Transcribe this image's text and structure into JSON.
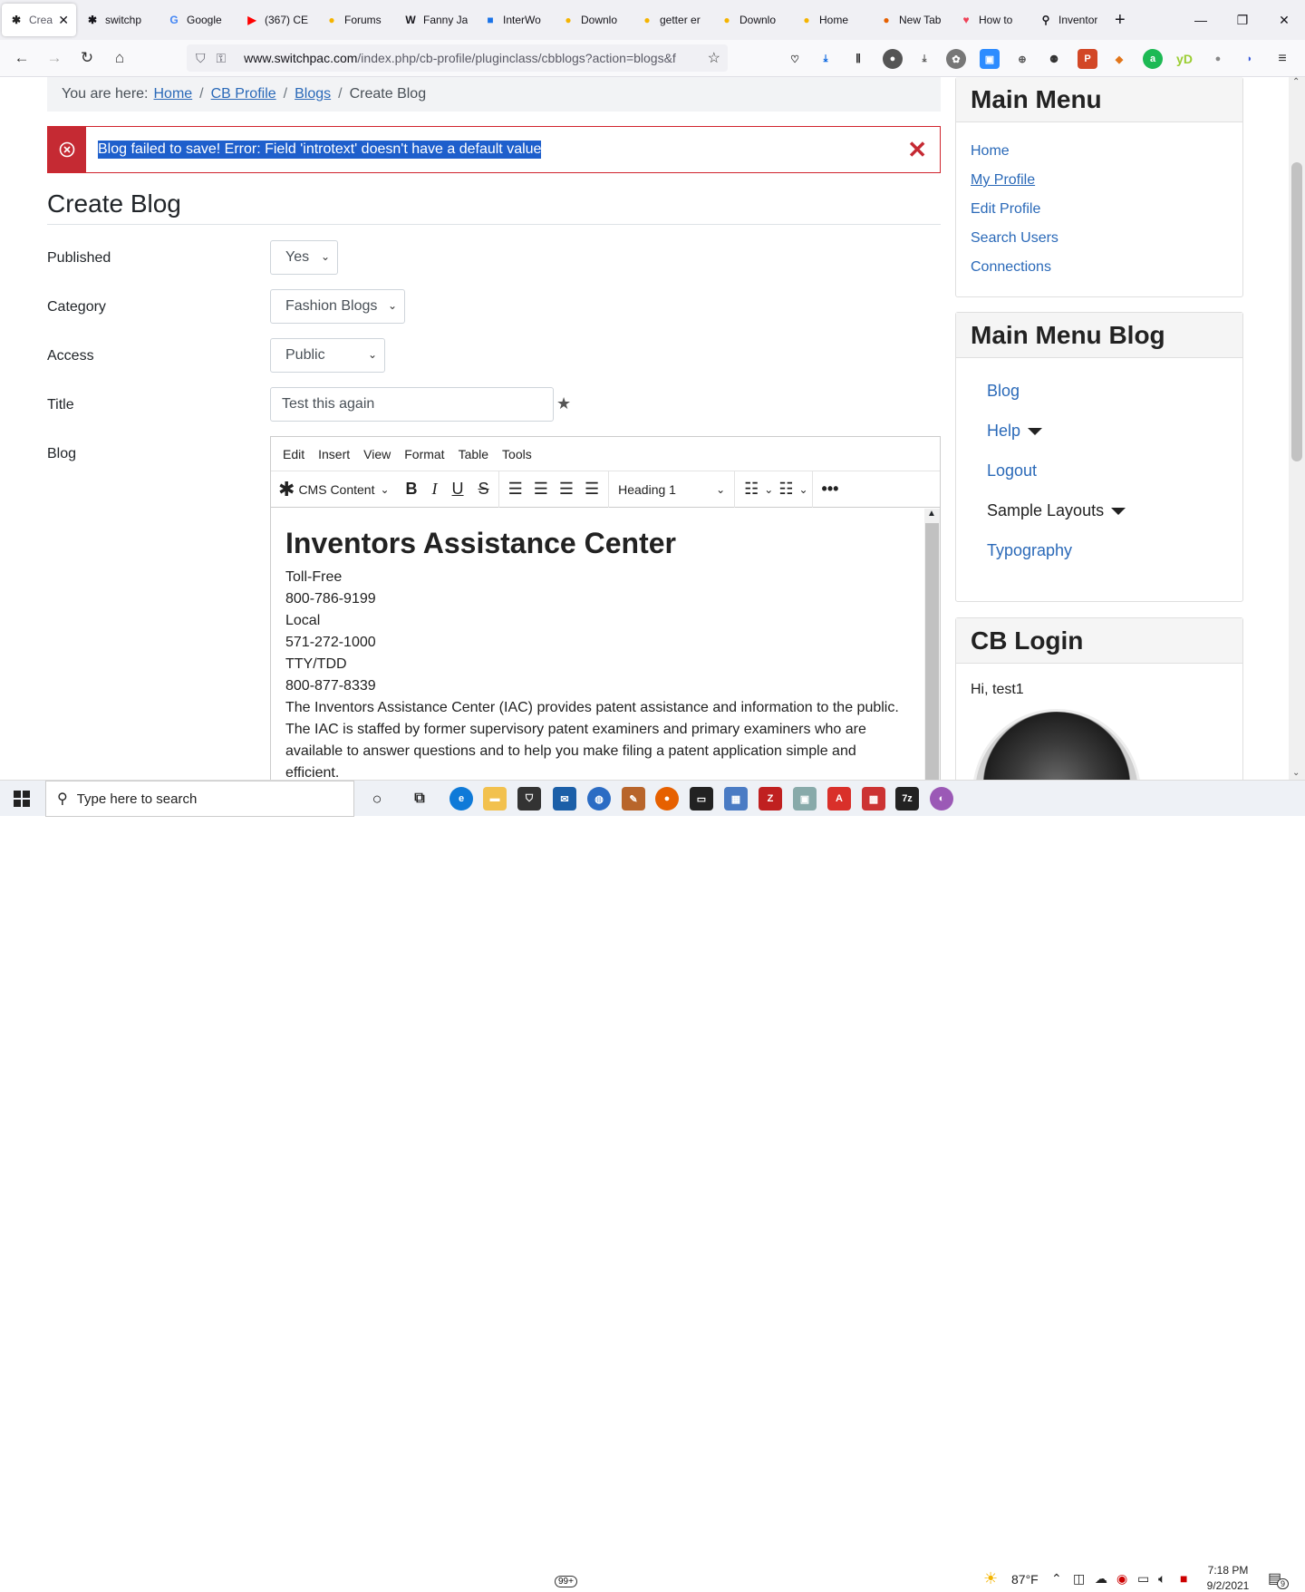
{
  "tabs": [
    {
      "label": "Creat",
      "icon": "joomla-icon",
      "active": true
    },
    {
      "label": "switchp",
      "icon": "joomla-icon"
    },
    {
      "label": "Google",
      "icon": "google-icon"
    },
    {
      "label": "(367) CE",
      "icon": "youtube-icon"
    },
    {
      "label": "Forums",
      "icon": "edge-icon"
    },
    {
      "label": "Fanny Ja",
      "icon": "wikipedia-icon"
    },
    {
      "label": "InterWo",
      "icon": "site-icon"
    },
    {
      "label": "Downlo",
      "icon": "edge-icon"
    },
    {
      "label": "getter er",
      "icon": "edge-icon"
    },
    {
      "label": "Downlo",
      "icon": "edge-icon"
    },
    {
      "label": "Home",
      "icon": "edge-icon"
    },
    {
      "label": "New Tab",
      "icon": "firefox-icon"
    },
    {
      "label": "How to",
      "icon": "pocket-icon"
    },
    {
      "label": "Inventor",
      "icon": "location-icon"
    }
  ],
  "url": {
    "host": "www.switchpac.com",
    "path": "/index.php/cb-profile/pluginclass/cbblogs?action=blogs&f"
  },
  "breadcrumb": {
    "prefix": "You are here:",
    "items": [
      "Home",
      "CB Profile",
      "Blogs"
    ],
    "current": "Create Blog"
  },
  "alert": {
    "message": "Blog failed to save! Error: Field 'introtext' doesn't have a default value",
    "close": "✕"
  },
  "form": {
    "heading": "Create Blog",
    "published_label": "Published",
    "published_value": "Yes",
    "category_label": "Category",
    "category_value": "Fashion Blogs",
    "access_label": "Access",
    "access_value": "Public",
    "title_label": "Title",
    "title_value": "Test this again",
    "blog_label": "Blog"
  },
  "editor": {
    "menu": [
      "Edit",
      "Insert",
      "View",
      "Format",
      "Table",
      "Tools"
    ],
    "cms_content": "CMS Content",
    "block_format": "Heading 1",
    "content_heading": "Inventors Assistance Center",
    "lines": [
      "Toll-Free",
      "800-786-9199",
      "Local",
      "571-272-1000",
      "TTY/TDD",
      "800-877-8339"
    ],
    "paragraph": "The Inventors Assistance Center (IAC) provides patent assistance and information to the public. The IAC is staffed by former supervisory patent examiners and primary examiners who are available to answer questions and to help you make filing a patent application simple and efficient."
  },
  "sidebar": {
    "main_menu": {
      "title": "Main Menu",
      "items": [
        "Home",
        "My Profile",
        "Edit Profile",
        "Search Users",
        "Connections"
      ]
    },
    "main_menu_blog": {
      "title": "Main Menu Blog",
      "items": [
        "Blog",
        "Help",
        "Logout",
        "Sample Layouts",
        "Typography"
      ]
    },
    "cb_login": {
      "title": "CB Login",
      "greeting": "Hi, test1"
    }
  },
  "taskbar": {
    "search_placeholder": "Type here to search",
    "weather": "87°F",
    "time": "7:18 PM",
    "date": "9/2/2021",
    "mail_badge": "99+",
    "notif_count": "9"
  }
}
